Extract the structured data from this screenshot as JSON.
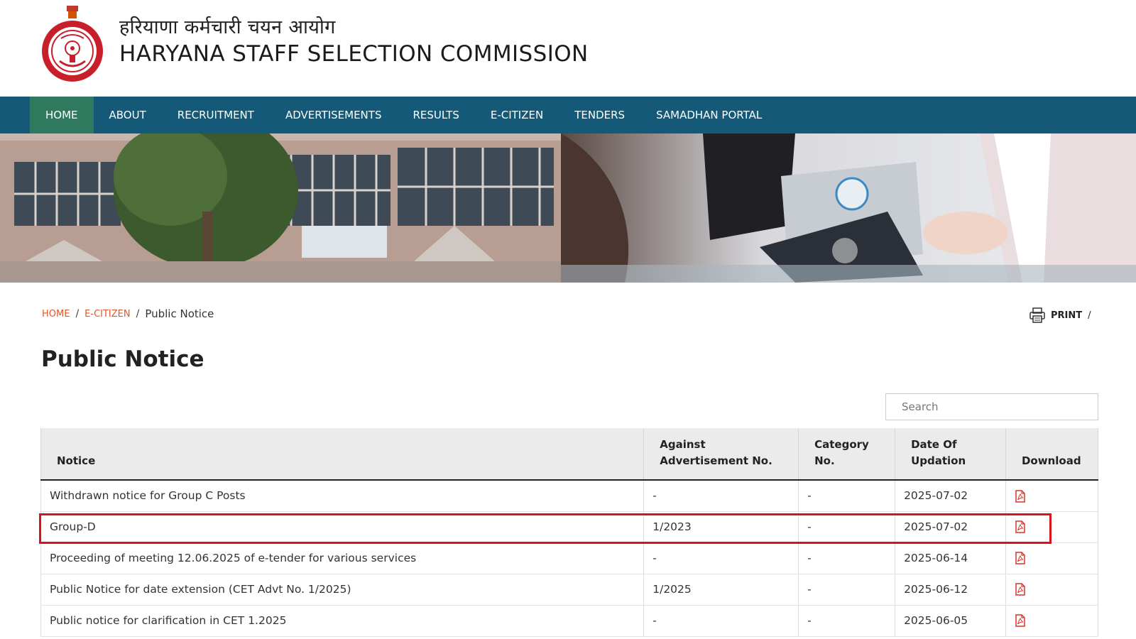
{
  "header": {
    "title_hindi": "हरियाणा कर्मचारी चयन आयोग",
    "title_english": "HARYANA STAFF SELECTION COMMISSION"
  },
  "nav": {
    "items": [
      {
        "label": "HOME",
        "active": true
      },
      {
        "label": "ABOUT",
        "active": false
      },
      {
        "label": "RECRUITMENT",
        "active": false
      },
      {
        "label": "ADVERTISEMENTS",
        "active": false
      },
      {
        "label": "RESULTS",
        "active": false
      },
      {
        "label": "E-CITIZEN",
        "active": false
      },
      {
        "label": "TENDERS",
        "active": false
      },
      {
        "label": "SAMADHAN PORTAL",
        "active": false
      }
    ]
  },
  "breadcrumb": {
    "home": "HOME",
    "ecitizen": "E-CITIZEN",
    "current": "Public Notice",
    "separator": "/"
  },
  "print": {
    "label": "PRINT",
    "separator": "/"
  },
  "page_title": "Public Notice",
  "search": {
    "placeholder": "Search",
    "value": ""
  },
  "table": {
    "headers": {
      "notice": "Notice",
      "adv_line1": "Against",
      "adv_line2": "Advertisement No.",
      "cat_line1": "Category",
      "cat_line2": "No.",
      "date_line1": "Date Of",
      "date_line2": "Updation",
      "download": "Download"
    },
    "rows": [
      {
        "notice": "Withdrawn notice for Group C Posts",
        "adv": "-",
        "cat": "-",
        "date": "2025-07-02"
      },
      {
        "notice": "Group-D",
        "adv": "1/2023",
        "cat": "-",
        "date": "2025-07-02"
      },
      {
        "notice": "Proceeding of meeting 12.06.2025 of e-tender for various services",
        "adv": "-",
        "cat": "-",
        "date": "2025-06-14"
      },
      {
        "notice": "Public Notice for date extension (CET Advt No. 1/2025)",
        "adv": "1/2025",
        "cat": "-",
        "date": "2025-06-12"
      },
      {
        "notice": "Public notice for clarification in CET 1.2025",
        "adv": "-",
        "cat": "-",
        "date": "2025-06-05"
      }
    ]
  },
  "colors": {
    "nav_bg": "#145a78",
    "nav_active": "#2f7a5e",
    "breadcrumb_link": "#e0552b",
    "highlight": "#d6141c",
    "pdf_icon": "#d9342b"
  },
  "icons": {
    "emblem": "haryana-emblem-icon",
    "print": "printer-icon",
    "download": "pdf-file-icon"
  }
}
